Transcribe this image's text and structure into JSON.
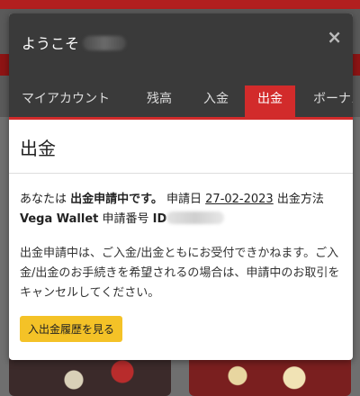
{
  "header": {
    "greeting": "ようこそ",
    "close_symbol": "×"
  },
  "tabs": [
    {
      "label": "マイアカウント"
    },
    {
      "label": "残高"
    },
    {
      "label": "入金"
    },
    {
      "label": "出金",
      "active": true
    },
    {
      "label": "ボーナス"
    }
  ],
  "main": {
    "title": "出金",
    "status": {
      "prefix": "あなたは",
      "emphasis": "出金申請中です。",
      "date_label": "申請日",
      "date": "27-02-2023",
      "method_label": "出金方法",
      "method": "Vega Wallet",
      "request_label": "申請番号",
      "id_label": "ID"
    },
    "notice": "出金申請中は、ご入金/出金ともにお受付できかねます。ご入金/出金のお手続きを希望されるの場合は、申請中のお取引をキャンセルしてください。",
    "history_button": "入出金履歴を見る"
  },
  "colors": {
    "accent": "#d22b2b",
    "header_bg": "#3a3a3a",
    "button": "#f4c227"
  }
}
